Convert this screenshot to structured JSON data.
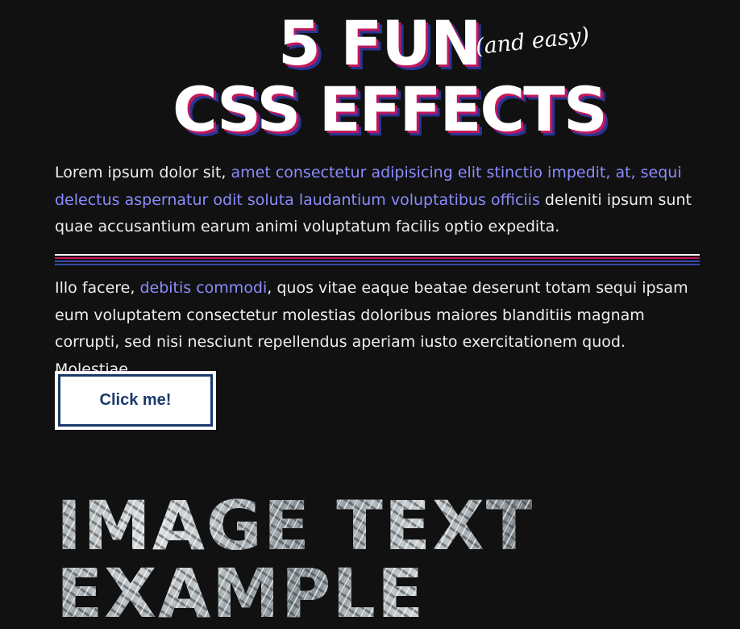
{
  "title": {
    "line1": "5 FUN",
    "aside": "(and easy)",
    "line2": "CSS EFFECTS"
  },
  "paragraph1": {
    "text_before": "Lorem ipsum dolor sit, ",
    "highlight": "amet consectetur adipisicing elit stinctio impedit, at, sequi delectus aspernatur odit soluta laudantium voluptatibus officiis",
    "text_after": " deleniti ipsum sunt quae accusantium earum animi voluptatum facilis optio expedita."
  },
  "paragraph2": {
    "text_before": "Illo facere, ",
    "highlight": "debitis commodi",
    "text_after": ", quos vitae eaque beatae deserunt totam sequi ipsam eum voluptatem consectetur molestias doloribus maiores blanditiis magnam corrupti, sed nisi nesciunt repellendus aperiam iusto exercitationem quod. Molestiae."
  },
  "button": {
    "label": "Click me!"
  },
  "image_text": {
    "line1": "IMAGE TEXT",
    "line2": "EXAMPLE"
  },
  "colors": {
    "background": "#111111",
    "text": "#eeeeee",
    "highlight": "#8c8cff",
    "accent_pink": "#c2185b",
    "accent_blue": "#283593",
    "button_text": "#1a3a6b"
  }
}
